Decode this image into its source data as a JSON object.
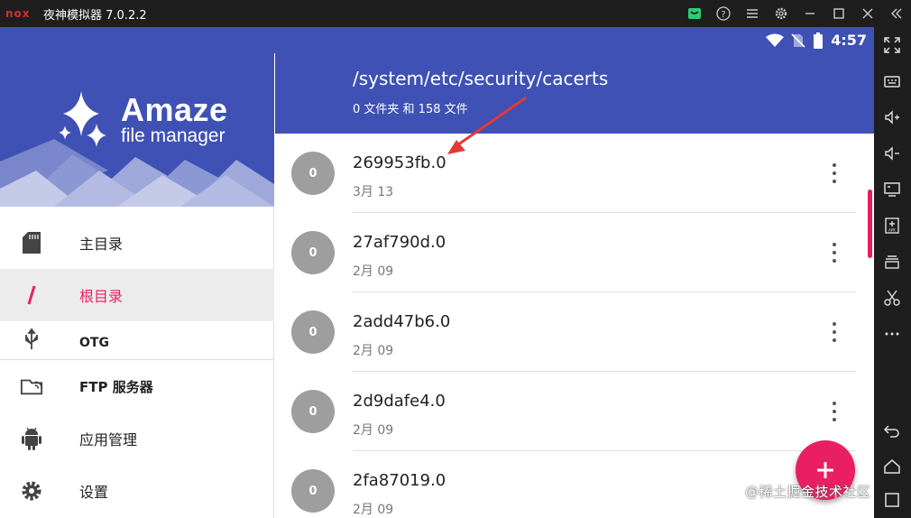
{
  "window": {
    "logo": "nox",
    "title": "夜神模拟器 7.0.2.2"
  },
  "statusbar": {
    "time": "4:57"
  },
  "drawer": {
    "brand_name": "Amaze",
    "brand_sub": "file manager",
    "items": [
      {
        "label": "主目录",
        "icon": "sd-card-icon"
      },
      {
        "label": "根目录",
        "icon": "slash-icon"
      },
      {
        "label": "OTG",
        "icon": "usb-icon"
      },
      {
        "label": "FTP 服务器",
        "icon": "ftp-icon"
      },
      {
        "label": "应用管理",
        "icon": "android-icon"
      },
      {
        "label": "设置",
        "icon": "gear-icon"
      }
    ]
  },
  "main": {
    "path": "/system/etc/security/cacerts",
    "summary": "0 文件夹 和 158 文件",
    "files": [
      {
        "avatar": "0",
        "name": "269953fb.0",
        "date": "3月 13"
      },
      {
        "avatar": "0",
        "name": "27af790d.0",
        "date": "2月 09"
      },
      {
        "avatar": "0",
        "name": "2add47b6.0",
        "date": "2月 09"
      },
      {
        "avatar": "0",
        "name": "2d9dafe4.0",
        "date": "2月 09"
      },
      {
        "avatar": "0",
        "name": "2fa87019.0",
        "date": "2月 09"
      }
    ]
  },
  "watermark": "@稀土掘金技术社区",
  "colors": {
    "primary": "#3f51b5",
    "accent": "#e91e63",
    "avatar": "#9e9e9e",
    "annotation_arrow": "#e53935"
  }
}
